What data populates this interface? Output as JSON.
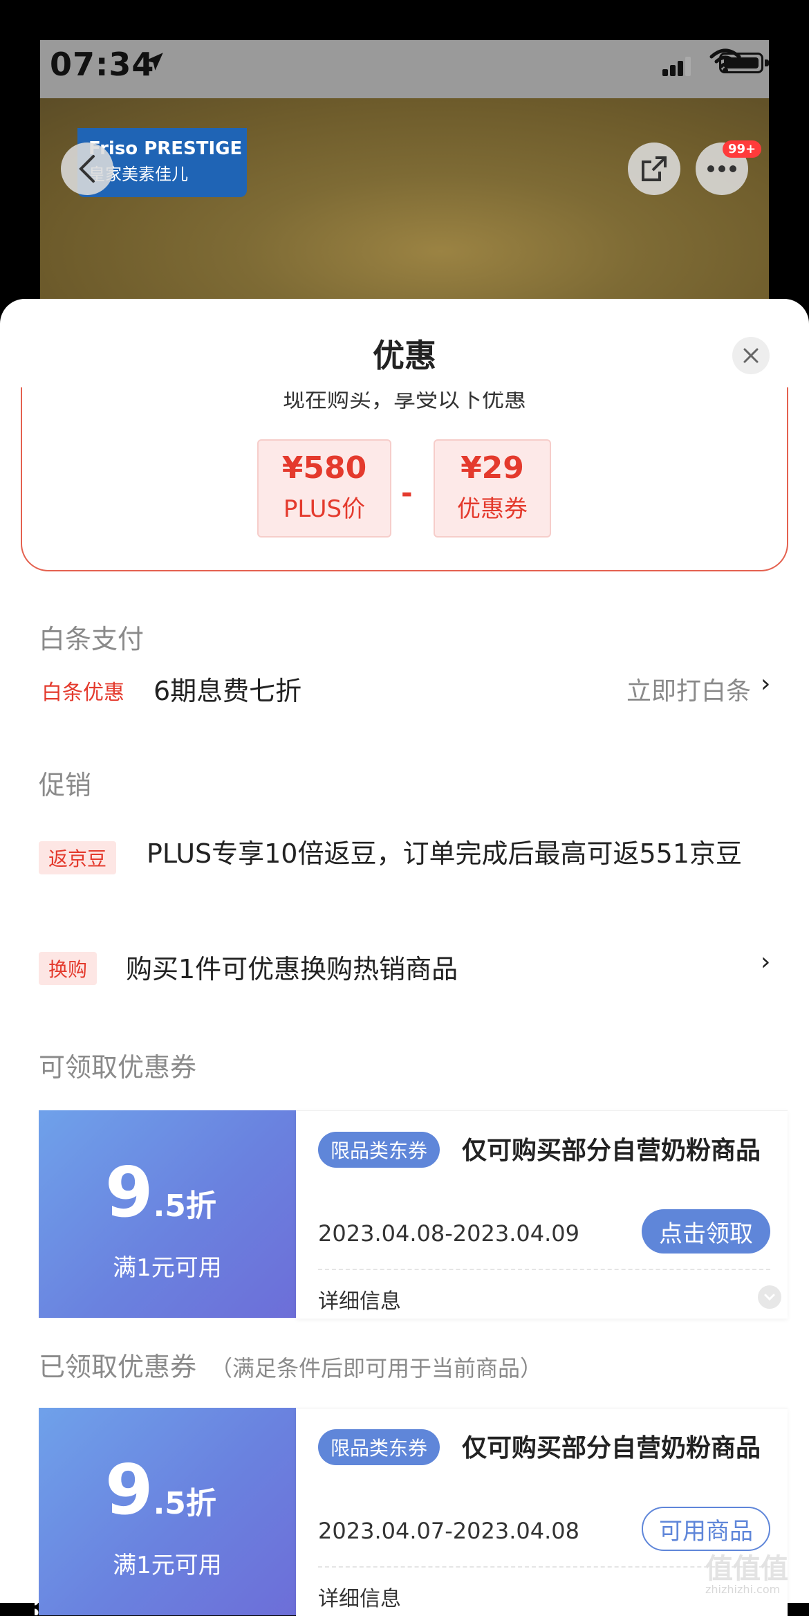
{
  "status_bar": {
    "time": "07:34"
  },
  "header": {
    "brand_line1": "Friso PRESTIGE",
    "brand_line2": "皇家美素佳儿",
    "cart_badge": "99+"
  },
  "sheet": {
    "title": "优惠",
    "summary_text": "现在购买，享受以下优惠",
    "price_box": {
      "value": "¥580",
      "label": "PLUS价"
    },
    "minus": "-",
    "coupon_box": {
      "value": "¥29",
      "label": "优惠券"
    }
  },
  "baitiao": {
    "section_title": "白条支付",
    "tag": "白条优惠",
    "text": "6期息费七折",
    "action": "立即打白条",
    "chevron": "›"
  },
  "promotion": {
    "section_title": "促销",
    "items": [
      {
        "tag": "返京豆",
        "text": "PLUS专享10倍返豆，订单完成后最高可返551京豆"
      },
      {
        "tag": "换购",
        "text": "购买1件可优惠换购热销商品",
        "chevron": "›"
      }
    ]
  },
  "available_coupons": {
    "section_title": "可领取优惠券",
    "coupon": {
      "discount_major": "9",
      "discount_minor": ".5折",
      "condition": "满1元可用",
      "type_tag": "限品类东券",
      "description": "仅可购买部分自营奶粉商品",
      "date_range": "2023.04.08-2023.04.09",
      "button": "点击领取",
      "detail": "详细信息"
    }
  },
  "claimed_coupons": {
    "section_title": "已领取优惠券",
    "section_note": "（满足条件后即可用于当前商品）",
    "coupon": {
      "discount_major": "9",
      "discount_minor": ".5折",
      "condition": "满1元可用",
      "type_tag": "限品类东券",
      "description": "仅可购买部分自营奶粉商品",
      "date_range": "2023.04.07-2023.04.08",
      "button": "可用商品",
      "detail": "详细信息"
    }
  },
  "watermark": {
    "main": "值值值",
    "sub": "zhizhizhi.com"
  },
  "colors": {
    "accent_red": "#e43a2d",
    "coupon_blue": "#5f86d9",
    "sheet_bg": "#ffffff"
  }
}
